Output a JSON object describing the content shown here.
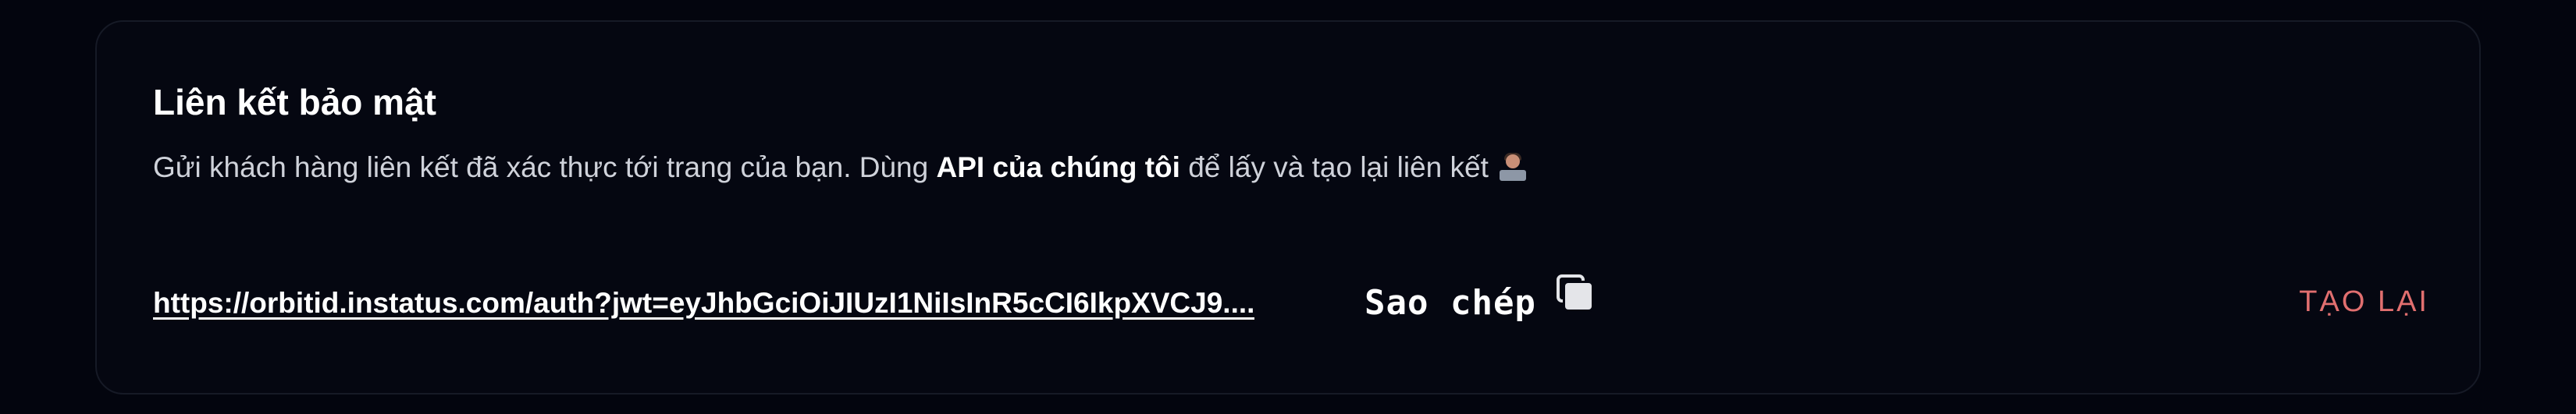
{
  "card": {
    "title": "Liên kết bảo mật",
    "description": {
      "before": "Gửi khách hàng liên kết đã xác thực tới trang của bạn. Dùng ",
      "strong": "API của chúng tôi",
      "after": " để lấy và tạo lại liên kết",
      "icon": "person-at-laptop-emoji"
    }
  },
  "link_row": {
    "url": "https://orbitid.instatus.com/auth?jwt=eyJhbGciOiJIUzI1NiIsInR5cCI6IkpXVCJ9....",
    "copy_label": "Sao chép",
    "copy_icon": "copy-icon",
    "regenerate_label": "TẠO LẠI"
  },
  "colors": {
    "background": "#03050e",
    "card": "#050711",
    "accent_danger": "#e16f6f",
    "text": "#ffffff",
    "muted_text": "#cfd2da"
  }
}
